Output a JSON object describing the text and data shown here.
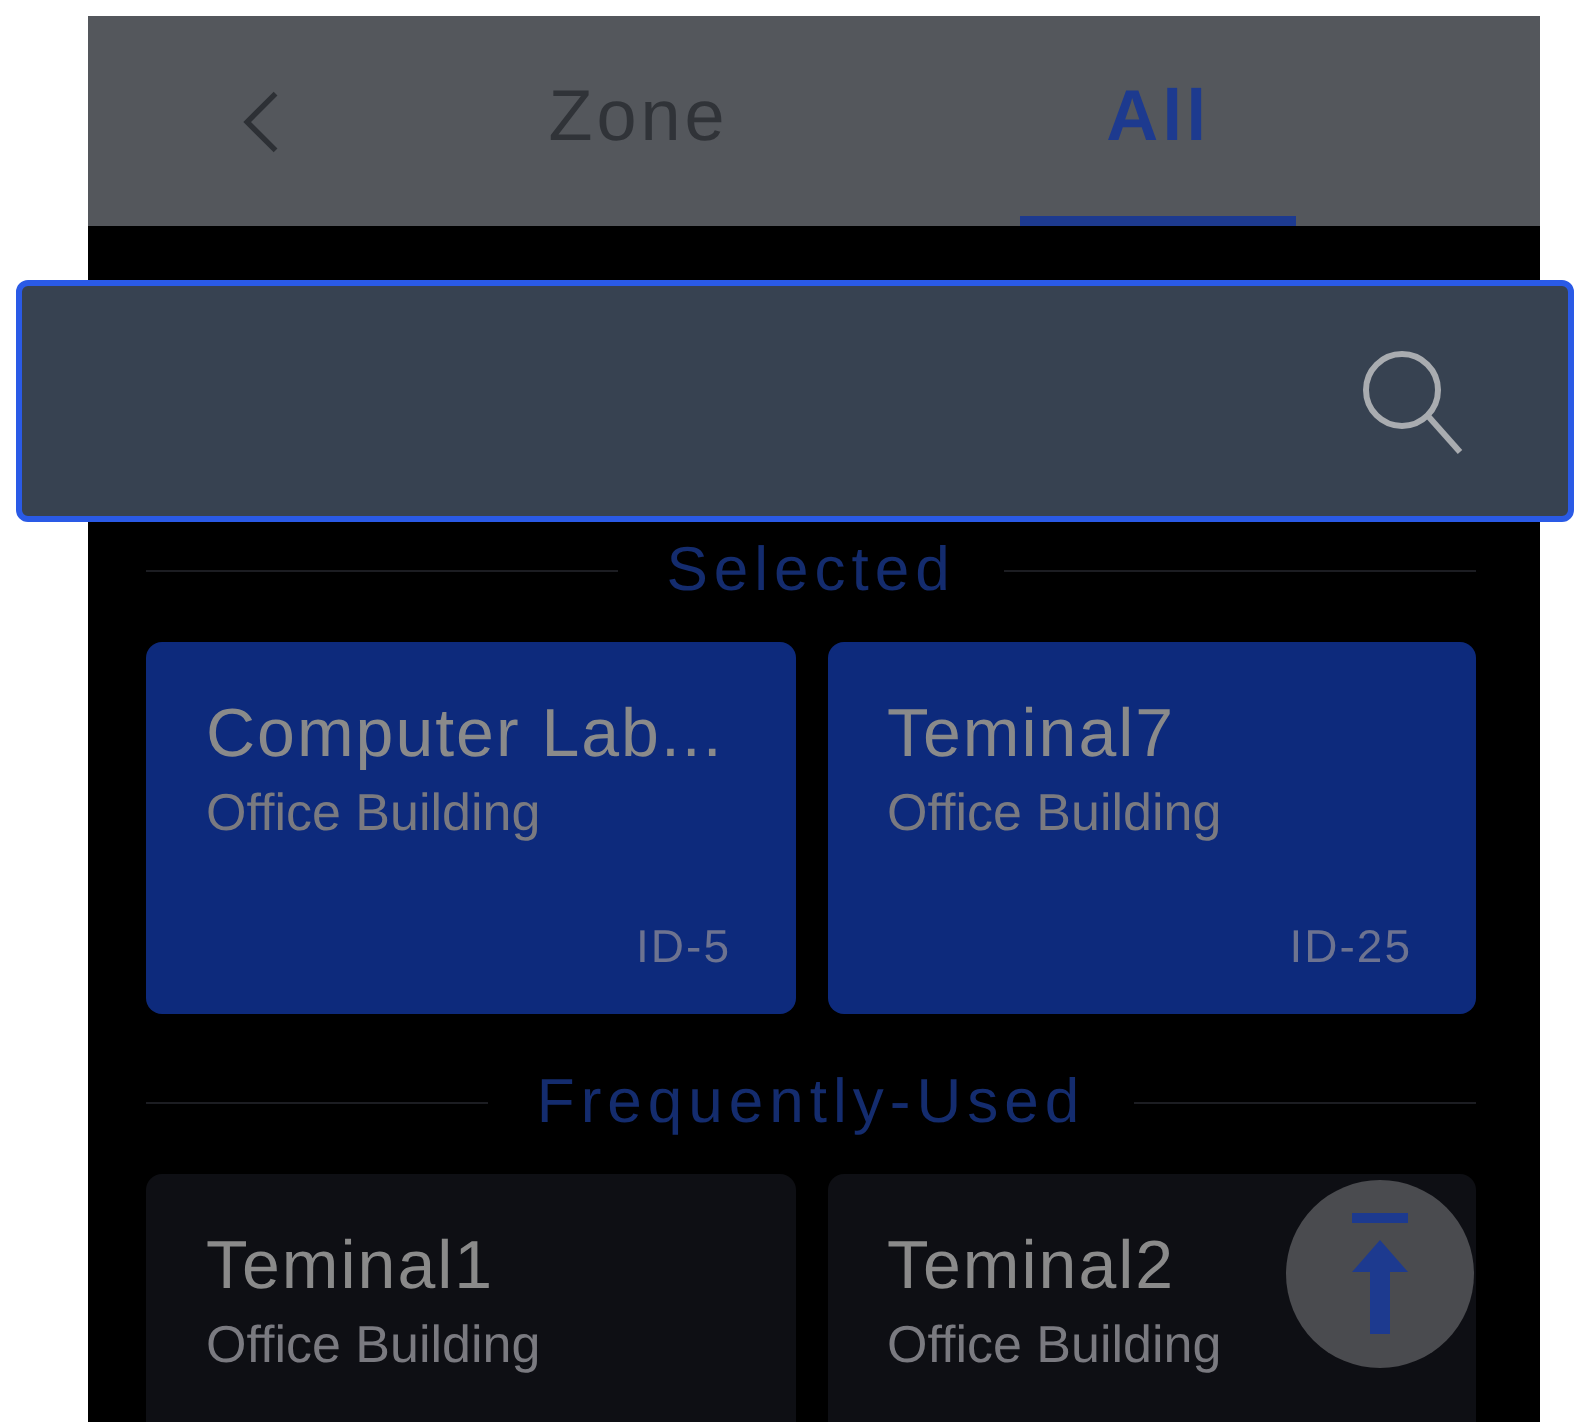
{
  "header": {
    "tabs": [
      {
        "label": "Zone",
        "selected": false
      },
      {
        "label": "All",
        "selected": true
      }
    ]
  },
  "search": {
    "highlighted": true
  },
  "sections": [
    {
      "title": "Selected",
      "items": [
        {
          "name": "Computer Lab...",
          "building": "Office Building",
          "id": "ID-5",
          "selected": true
        },
        {
          "name": "Teminal7",
          "building": "Office Building",
          "id": "ID-25",
          "selected": true
        }
      ]
    },
    {
      "title": "Frequently-Used",
      "items": [
        {
          "name": "Teminal1",
          "building": "Office Building",
          "selected": false
        },
        {
          "name": "Teminal2",
          "building": "Office Building",
          "selected": false
        }
      ]
    }
  ]
}
